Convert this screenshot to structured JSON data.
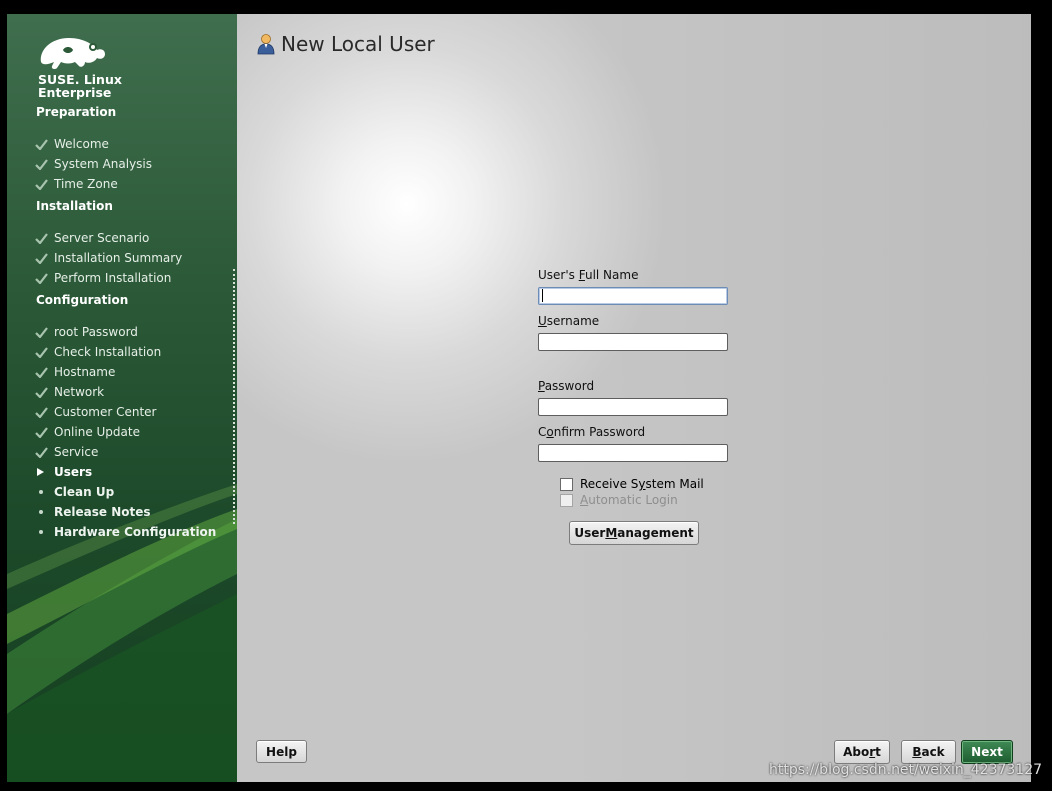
{
  "brand": {
    "line1": "SUSE.",
    "line1b": "Linux",
    "line2": "Enterprise"
  },
  "sidebar": {
    "sections": [
      {
        "title": "Preparation",
        "steps": [
          {
            "label": "Welcome",
            "state": "done"
          },
          {
            "label": "System Analysis",
            "state": "done"
          },
          {
            "label": "Time Zone",
            "state": "done"
          }
        ]
      },
      {
        "title": "Installation",
        "steps": [
          {
            "label": "Server Scenario",
            "state": "done"
          },
          {
            "label": "Installation Summary",
            "state": "done"
          },
          {
            "label": "Perform Installation",
            "state": "done"
          }
        ]
      },
      {
        "title": "Configuration",
        "steps": [
          {
            "label": "root Password",
            "state": "done"
          },
          {
            "label": "Check Installation",
            "state": "done"
          },
          {
            "label": "Hostname",
            "state": "done"
          },
          {
            "label": "Network",
            "state": "done"
          },
          {
            "label": "Customer Center",
            "state": "done"
          },
          {
            "label": "Online Update",
            "state": "done"
          },
          {
            "label": "Service",
            "state": "done"
          },
          {
            "label": "Users",
            "state": "current"
          },
          {
            "label": "Clean Up",
            "state": "todo"
          },
          {
            "label": "Release Notes",
            "state": "todo"
          },
          {
            "label": "Hardware Configuration",
            "state": "todo"
          }
        ]
      }
    ]
  },
  "page": {
    "title": "New Local User",
    "icon": "user-icon"
  },
  "form": {
    "full_name": {
      "label_pre": "User's ",
      "label_u": "F",
      "label_post": "ull Name",
      "value": ""
    },
    "username": {
      "label_pre": "",
      "label_u": "U",
      "label_post": "sername",
      "value": ""
    },
    "password": {
      "label_pre": "",
      "label_u": "P",
      "label_post": "assword",
      "value": ""
    },
    "confirm_password": {
      "label_pre": "C",
      "label_u": "o",
      "label_post": "nfirm Password",
      "value": ""
    },
    "receive_mail": {
      "label_pre": "Receive S",
      "label_u": "y",
      "label_post": "stem Mail",
      "checked": false
    },
    "auto_login": {
      "label_pre": "",
      "label_u": "A",
      "label_post": "utomatic Login",
      "checked": false,
      "disabled": true
    },
    "user_mgmt": {
      "label_pre": "User ",
      "label_u": "M",
      "label_post": "anagement"
    }
  },
  "buttons": {
    "help": "Help",
    "abort_pre": "Abo",
    "abort_u": "r",
    "abort_post": "t",
    "back_pre": "",
    "back_u": "B",
    "back_post": "ack",
    "next": "Next"
  },
  "watermark": "https://blog.csdn.net/weixin_42373127",
  "colors": {
    "accent": "#1d5c30",
    "sidebar": "#2c5a38"
  }
}
